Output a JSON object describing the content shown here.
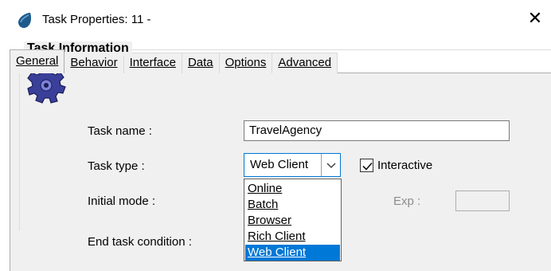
{
  "window": {
    "title": "Task Properties: 11 -",
    "close_glyph": "✕"
  },
  "tabs": [
    {
      "label": "General",
      "active": true
    },
    {
      "label": "Behavior",
      "active": false
    },
    {
      "label": "Interface",
      "active": false
    },
    {
      "label": "Data",
      "active": false
    },
    {
      "label": "Options",
      "active": false
    },
    {
      "label": "Advanced",
      "active": false
    }
  ],
  "group": {
    "title": "Task Information",
    "icon": "gear-icon"
  },
  "fields": {
    "task_name_label": "Task name :",
    "task_name_value": "TravelAgency",
    "task_type_label": "Task type :",
    "task_type_value": "Web Client",
    "interactive_label": "Interactive",
    "interactive_checked": true,
    "initial_mode_label": "Initial mode :",
    "exp_label": "Exp :",
    "end_task_label": "End task condition :"
  },
  "dropdown": {
    "options": [
      "Online",
      "Batch",
      "Browser",
      "Rich Client",
      "Web Client"
    ],
    "selected": "Web Client"
  },
  "colors": {
    "selection": "#0078d7",
    "panel": "#f0f0f0",
    "disabled_text": "#8c8c8c"
  }
}
